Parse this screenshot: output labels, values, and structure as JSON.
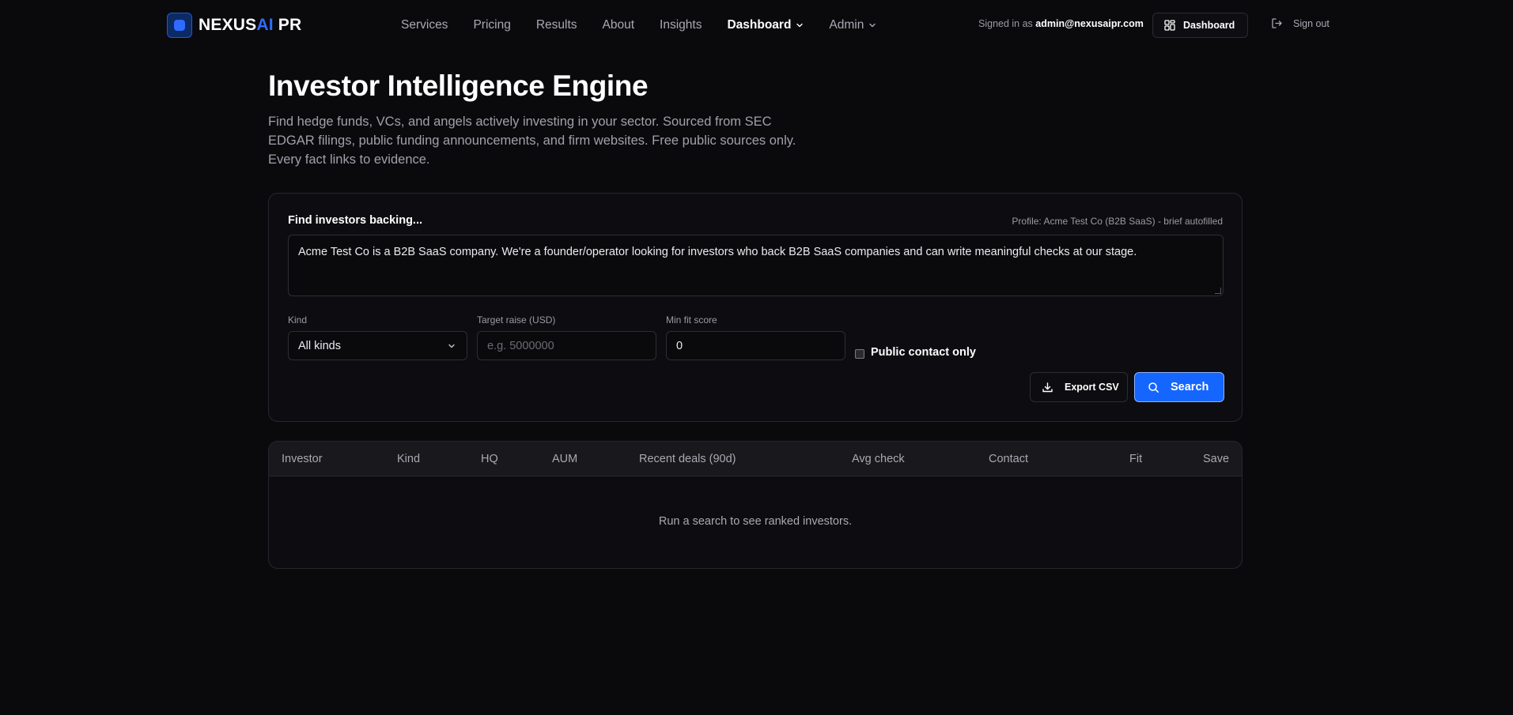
{
  "brand": {
    "name_prefix": "NEXUS",
    "name_ai": "AI",
    "name_suffix": " PR"
  },
  "nav": {
    "links": [
      {
        "label": "Services"
      },
      {
        "label": "Pricing"
      },
      {
        "label": "Results"
      },
      {
        "label": "About"
      },
      {
        "label": "Insights"
      },
      {
        "label": "Dashboard"
      },
      {
        "label": "Admin"
      }
    ],
    "signed_in_prefix": "Signed in as ",
    "signed_in_email": "admin@nexusaipr.com",
    "dashboard_button": "Dashboard",
    "sign_out": "Sign out"
  },
  "hero": {
    "title": "Investor Intelligence Engine",
    "subtitle": "Find hedge funds, VCs, and angels actively investing in your sector. Sourced from SEC EDGAR filings, public funding announcements, and firm websites. Free public sources only. Every fact links to evidence."
  },
  "search_card": {
    "label": "Find investors backing...",
    "profile_note": "Profile: Acme Test Co (B2B SaaS) - brief autofilled",
    "brief_value": "Acme Test Co is a B2B SaaS company. We're a founder/operator looking for investors who back B2B SaaS companies and can write meaningful checks at our stage.",
    "kind_label": "Kind",
    "kind_value": "All kinds",
    "raise_label": "Target raise (USD)",
    "raise_placeholder": "e.g. 5000000",
    "fit_label": "Min fit score",
    "fit_value": "0",
    "public_contact_label": "Public contact only",
    "public_contact_checked": false,
    "export_label": "Export CSV",
    "search_label": "Search"
  },
  "results": {
    "columns": [
      "Investor",
      "Kind",
      "HQ",
      "AUM",
      "Recent deals (90d)",
      "Avg check",
      "Contact",
      "Fit",
      "Save"
    ],
    "empty_message": "Run a search to see ranked investors."
  },
  "colors": {
    "background": "#0a0a0d",
    "accent": "#1466ff",
    "card": "#0d0d11",
    "border": "#26262e"
  },
  "icons": [
    "logo-icon",
    "chevron-down-icon",
    "grid-icon",
    "sign-out-icon",
    "download-icon",
    "search-icon"
  ]
}
